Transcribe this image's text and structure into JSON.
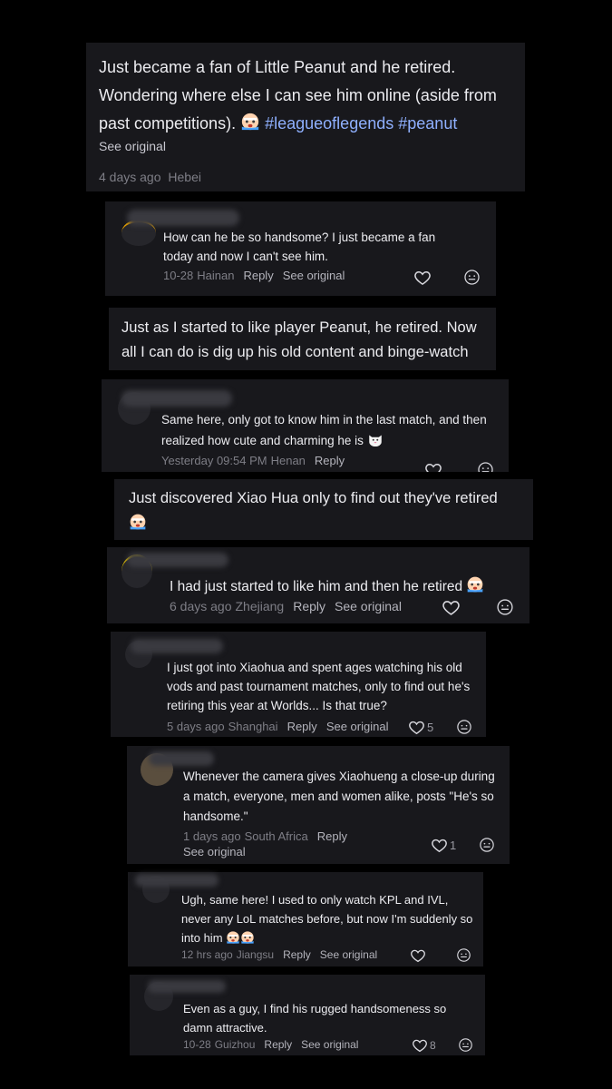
{
  "post": {
    "text": "Just became a fan of Little Peanut and he retired. Wondering where else I can see him online (aside from past competitions).",
    "emoji": "crying-face-emoji",
    "hashtags": [
      "#leagueoflegends",
      "#peanut"
    ],
    "see_original": "See original",
    "time": "4 days ago",
    "location": "Hebei"
  },
  "labels": {
    "reply": "Reply",
    "see_original": "See original"
  },
  "comments": [
    {
      "text": "How can he be so handsome? I just became a fan today and now I can't see him.",
      "time": "10-28",
      "location": "Hainan"
    },
    {
      "text": "Just as I started to like player Peanut, he retired. Now all I can do is dig up his old content and binge-watch"
    },
    {
      "text": "Same here, only got to know him in the last match, and then realized how cute and charming he is",
      "time": "Yesterday 09:54 PM",
      "location": "Henan"
    },
    {
      "text": "Just discovered Xiao Hua only to find out they've retired"
    },
    {
      "text": "I had just started to like him and then he retired",
      "time": "6 days ago",
      "location": "Zhejiang"
    },
    {
      "text": "I just got into Xiaohua and spent ages watching his old vods and past tournament matches, only to find out he's retiring this year at Worlds... Is that true?",
      "time": "5 days ago",
      "location": "Shanghai",
      "likes": "5"
    },
    {
      "text": "Whenever the camera gives Xiaohueng a close-up during a match, everyone, men and women alike, posts \"He's so handsome.\"",
      "time": "1 days ago",
      "location": "South Africa",
      "likes": "1"
    },
    {
      "text": "Ugh, same here! I used to only watch KPL and IVL, never any LoL matches before, but now I'm suddenly so into him",
      "time": "12 hrs ago",
      "location": "Jiangsu"
    },
    {
      "text": "Even as a guy, I find his rugged handsomeness so damn attractive.",
      "time": "10-28",
      "location": "Guizhou",
      "likes": "8"
    }
  ],
  "icons": [
    "heart-icon",
    "comment-face-icon",
    "crying-face-emoji",
    "cat-face-emoji"
  ],
  "colors": {
    "background": "#000000",
    "card": "#18181c",
    "hashtag": "#8fb0ff",
    "muted": "#7e7e86"
  }
}
